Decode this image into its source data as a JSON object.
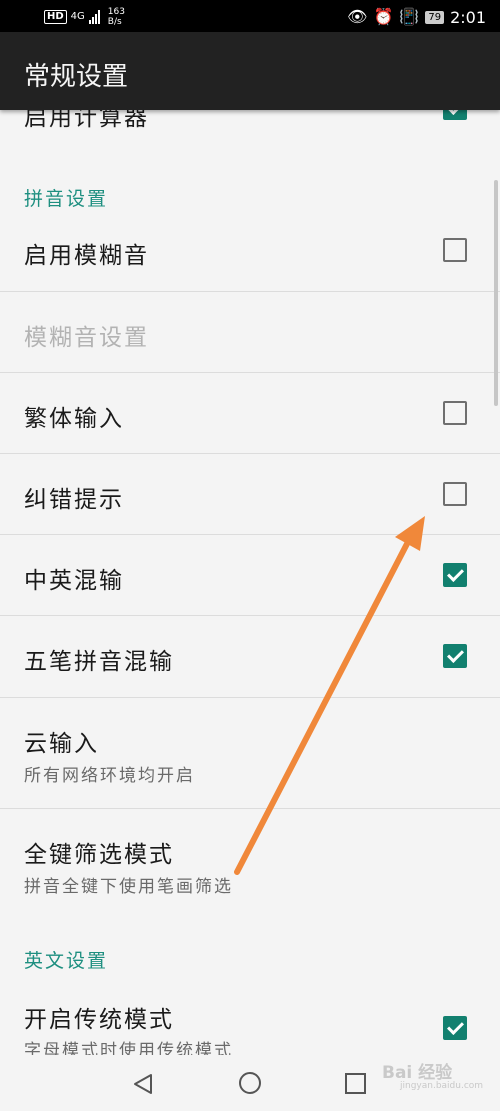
{
  "status_bar": {
    "hd": "HD",
    "network": "4G",
    "speed_value": "163",
    "speed_unit": "B/s",
    "battery": "79",
    "time": "2:01"
  },
  "header": {
    "title": "常规设置"
  },
  "items": {
    "calculator": {
      "label": "启用计算器",
      "checked": true
    },
    "pinyin_section": "拼音设置",
    "fuzzy": {
      "label": "启用模糊音",
      "checked": false
    },
    "fuzzy_settings": {
      "label": "模糊音设置",
      "enabled": false
    },
    "traditional": {
      "label": "繁体输入",
      "checked": false
    },
    "correction": {
      "label": "纠错提示",
      "checked": false
    },
    "mixed_cn_en": {
      "label": "中英混输",
      "checked": true
    },
    "wubi_pinyin": {
      "label": "五笔拼音混输",
      "checked": true
    },
    "cloud": {
      "label": "云输入",
      "sub": "所有网络环境均开启"
    },
    "full_key": {
      "label": "全键筛选模式",
      "sub": "拼音全键下使用笔画筛选"
    },
    "english_section": "英文设置",
    "traditional_mode": {
      "label": "开启传统模式",
      "sub": "字母模式时使用传统模式",
      "checked": true
    }
  },
  "watermark": {
    "text": "Bai 经验",
    "url": "jingyan.baidu.com"
  },
  "colors": {
    "accent": "#12806f",
    "section_text": "#1e8f80",
    "annotation_arrow": "#f0883a"
  }
}
